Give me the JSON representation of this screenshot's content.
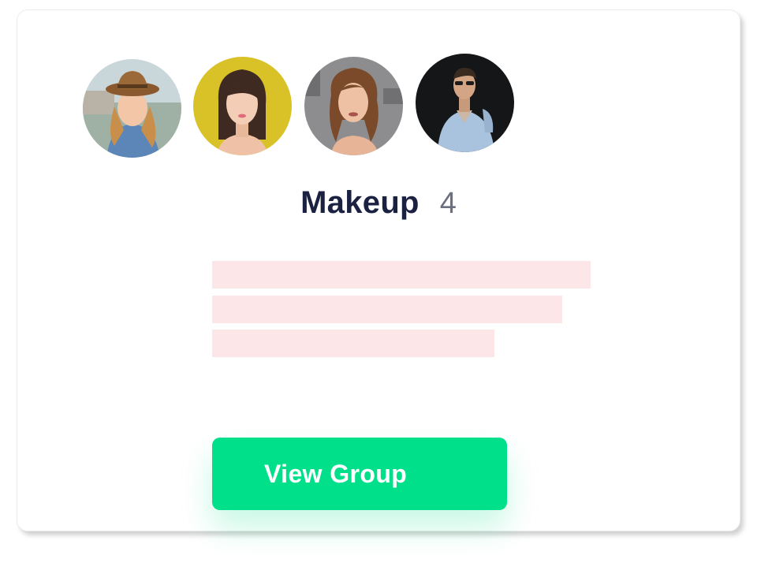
{
  "group": {
    "name": "Makeup",
    "member_count": "4"
  },
  "members": [
    {
      "avatar": "member-avatar-1"
    },
    {
      "avatar": "member-avatar-2"
    },
    {
      "avatar": "member-avatar-3"
    },
    {
      "avatar": "member-avatar-4"
    }
  ],
  "actions": {
    "view_group_label": "View Group"
  },
  "colors": {
    "button": "#00e08a",
    "title": "#1b2140",
    "count": "#6b7080",
    "placeholder": "#fde6e8"
  }
}
